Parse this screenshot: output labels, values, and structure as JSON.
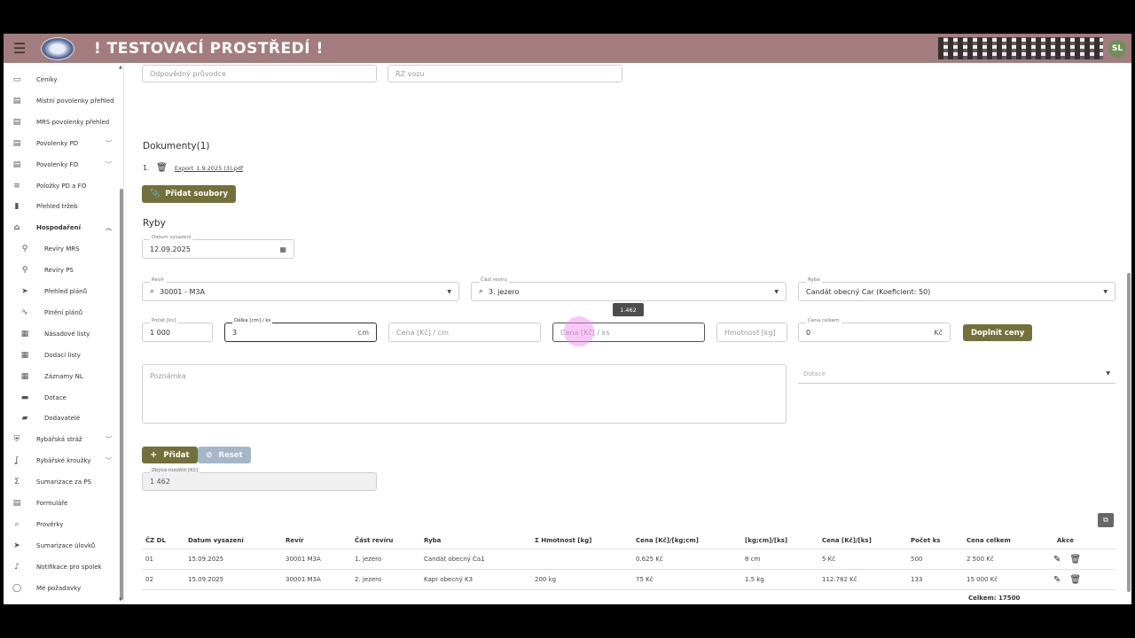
{
  "header": {
    "app_title": "! TESTOVACÍ PROSTŘEDÍ !",
    "avatar_initials": "SL",
    "accent_color": "#a27c7e"
  },
  "sidebar": {
    "items": [
      {
        "label": "Ceníky",
        "icon": "price-list-icon"
      },
      {
        "label": "Místní povolenky přehled",
        "icon": "id-card-icon"
      },
      {
        "label": "MRS povolenky přehled",
        "icon": "id-card-icon"
      },
      {
        "label": "Povolenky PD",
        "icon": "document-icon",
        "expandable": true
      },
      {
        "label": "Povolenky FO",
        "icon": "document-icon",
        "expandable": true
      },
      {
        "label": "Položky PD a FO",
        "icon": "list-icon"
      },
      {
        "label": "Přehled tržeb",
        "icon": "bar-chart-icon"
      },
      {
        "label": "Hospodaření",
        "icon": "home-icon",
        "expandable": true,
        "expanded": true
      },
      {
        "label": "Revíry MRS",
        "icon": "location-pin-icon",
        "sub": true
      },
      {
        "label": "Revíry PS",
        "icon": "location-pin-icon",
        "sub": true
      },
      {
        "label": "Přehled plánů",
        "icon": "fish-icon",
        "sub": true
      },
      {
        "label": "Plnění plánů",
        "icon": "trend-icon",
        "sub": true
      },
      {
        "label": "Násadové listy",
        "icon": "sheet-icon",
        "sub": true
      },
      {
        "label": "Dodací listy",
        "icon": "sheet-icon",
        "sub": true
      },
      {
        "label": "Záznamy NL",
        "icon": "sheet-icon",
        "sub": true
      },
      {
        "label": "Dotace",
        "icon": "money-icon",
        "sub": true
      },
      {
        "label": "Dodavatelé",
        "icon": "truck-icon",
        "sub": true
      },
      {
        "label": "Rybářská stráž",
        "icon": "shield-icon",
        "expandable": true
      },
      {
        "label": "Rybářské kroužky",
        "icon": "hook-icon",
        "expandable": true
      },
      {
        "label": "Sumarizace za PS",
        "icon": "sigma-icon"
      },
      {
        "label": "Formuláře",
        "icon": "form-icon"
      },
      {
        "label": "Prověrky",
        "icon": "search-icon"
      },
      {
        "label": "Sumarizace úlovků",
        "icon": "fish-icon"
      },
      {
        "label": "Notifikace pro spolek",
        "icon": "bell-icon"
      },
      {
        "label": "Mé požadavky",
        "icon": "chat-icon"
      }
    ]
  },
  "top_fields": {
    "guide_placeholder": "Odpovědný průvodce",
    "car_placeholder": "RZ vozu"
  },
  "documents": {
    "title": "Dokumenty(1)",
    "items": [
      {
        "index": "1.",
        "name": "Export_1.9.2025 (3).pdf"
      }
    ],
    "add_files_label": "Přidat soubory"
  },
  "fish": {
    "title": "Ryby",
    "date_label": "Datum vysazení",
    "date_value": "12.09.2025",
    "revir_label": "Revír",
    "revir_value": "30001 - M3A",
    "cast_label": "Část revíru",
    "cast_value": "3. jezero",
    "ryba_label": "Ryba",
    "ryba_value": "Candát obecný Car (Koeficient: 50)",
    "pocet_label": "Počet [ks]",
    "pocet_value": "1 000",
    "delka_label": "Délka [cm] / ks",
    "delka_value": "3",
    "delka_suffix": "cm",
    "cena_cm_placeholder": "Cena [Kč] / cm",
    "cena_ks_placeholder": "Cena [Kč] / ks",
    "tooltip": "1.462",
    "hmotnost_placeholder": "Hmotnost [kg]",
    "cena_celkem_label": "Cena celkem",
    "cena_celkem_value": "0",
    "cena_celkem_suffix": "Kč",
    "fill_prices_label": "Doplnit ceny",
    "note_placeholder": "Poznámka",
    "dotace_placeholder": "Dotace",
    "add_label": "Přidat",
    "reset_label": "Reset",
    "remaining_label": "Zbývá rozdělit [Kč]",
    "remaining_value": "1 462"
  },
  "table": {
    "headers": [
      "ČZ DL",
      "Datum vysazení",
      "Revír",
      "Část revíru",
      "Ryba",
      "Σ Hmotnost [kg]",
      "Cena [Kč]/[kg;cm]",
      "[kg;cm]/[ks]",
      "Cena [Kč]/[ks]",
      "Počet ks",
      "Cena celkem",
      "Akce"
    ],
    "rows": [
      [
        "01",
        "15.09.2025",
        "30001 M3A",
        "1. jezero",
        "Candát obecný Ca1",
        "",
        "0.625 Kč",
        "8 cm",
        "5 Kč",
        "500",
        "2 500 Kč"
      ],
      [
        "02",
        "15.09.2025",
        "30001 M3A",
        "2. jezero",
        "Kapr obecný K3",
        "200 kg",
        "75 Kč",
        "1.5 kg",
        "112.782 Kč",
        "133",
        "15 000 Kč"
      ]
    ],
    "total": "Celkem: 17500"
  }
}
